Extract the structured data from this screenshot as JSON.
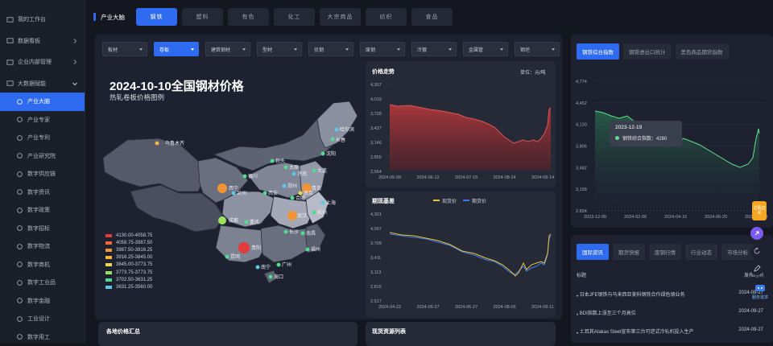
{
  "sidebar": {
    "items": [
      {
        "label": "我的工作台",
        "icon": "monitor-icon",
        "type": "top"
      },
      {
        "label": "数据看板",
        "icon": "dashboard-icon",
        "type": "top",
        "arrow": "right"
      },
      {
        "label": "企业内部管理",
        "icon": "building-icon",
        "type": "top",
        "arrow": "right"
      },
      {
        "label": "大数据赋能",
        "icon": "database-icon",
        "type": "top",
        "arrow": "down"
      },
      {
        "label": "产业大脑",
        "icon": "brain-icon",
        "type": "sub",
        "active": true
      },
      {
        "label": "产业专家",
        "icon": "expert-icon",
        "type": "sub"
      },
      {
        "label": "产业专利",
        "icon": "patent-icon",
        "type": "sub"
      },
      {
        "label": "产业研究院",
        "icon": "research-icon",
        "type": "sub"
      },
      {
        "label": "数字供应链",
        "icon": "supply-chain-icon",
        "type": "sub"
      },
      {
        "label": "数字资讯",
        "icon": "news-icon",
        "type": "sub"
      },
      {
        "label": "数字政策",
        "icon": "policy-icon",
        "type": "sub"
      },
      {
        "label": "数字招标",
        "icon": "bid-icon",
        "type": "sub"
      },
      {
        "label": "数字物流",
        "icon": "truck-icon",
        "type": "sub"
      },
      {
        "label": "数字商机",
        "icon": "opportunity-icon",
        "type": "sub"
      },
      {
        "label": "数字工业品",
        "icon": "product-icon",
        "type": "sub"
      },
      {
        "label": "数字金融",
        "icon": "finance-icon",
        "type": "sub"
      },
      {
        "label": "工业设计",
        "icon": "design-icon",
        "type": "sub"
      },
      {
        "label": "数字用工",
        "icon": "worker-icon",
        "type": "sub"
      }
    ]
  },
  "header": {
    "brand": "产业大脑",
    "tabs": [
      "钢铁",
      "塑料",
      "有色",
      "化工",
      "大宗商品",
      "纺织",
      "食品"
    ],
    "active_tab": 0
  },
  "filters": {
    "items": [
      "板材",
      "卷板",
      "建筑钢材",
      "型材",
      "优钢",
      "废钢",
      "冷镀",
      "金属管",
      "钢坯"
    ],
    "active": 1
  },
  "map": {
    "title": "2024-10-10全国钢材价格",
    "subtitle": "热轧卷板价格图例",
    "cities": [
      "乌鲁木齐",
      "哈尔滨",
      "长春",
      "沈阳",
      "包头",
      "大连",
      "银川",
      "太原",
      "济南",
      "西宁",
      "兰州",
      "郑州",
      "西安",
      "青岛",
      "合肥",
      "南京",
      "上海",
      "杭州",
      "武汉",
      "成都",
      "重庆",
      "长沙",
      "南昌",
      "福州",
      "贵阳",
      "昆明",
      "南宁",
      "广州",
      "海口"
    ],
    "legend": [
      {
        "label": "4130.00-4058.75",
        "color": "#e23b3b"
      },
      {
        "label": "4058.75-3987.50",
        "color": "#ef6a3a"
      },
      {
        "label": "3987.50-3916.25",
        "color": "#f09438"
      },
      {
        "label": "3916.25-3845.00",
        "color": "#f4b43f"
      },
      {
        "label": "3845.00-3773.75",
        "color": "#e8d84a"
      },
      {
        "label": "3773.75-3773.75",
        "color": "#9be35a"
      },
      {
        "label": "3702.50-3631.25",
        "color": "#55d98f"
      },
      {
        "label": "3631.25-3560.00",
        "color": "#5ec7e8"
      }
    ]
  },
  "price_trend": {
    "title": "价格走势",
    "unit": "单位：元/吨",
    "y_ticks": [
      "4,307",
      "4,019",
      "3,728",
      "3,437",
      "3,146",
      "2,855",
      "2,564"
    ],
    "x_ticks": [
      "2024-05-09",
      "2024-06-12",
      "2024-07-15",
      "2024-08-14",
      "2024-09-14"
    ]
  },
  "futures": {
    "title": "期现基差",
    "legend": [
      "现货价",
      "期货价"
    ],
    "y_ticks": [
      "4,301",
      "4,007",
      "3,709",
      "3,411",
      "3,113",
      "2,815",
      "2,517"
    ],
    "x_ticks": [
      "2024-04-22",
      "2024-05-27",
      "2024-06-27",
      "2024-08-06",
      "2024-09-11"
    ]
  },
  "bottom_left_title": "各地价格汇总",
  "bottom_mid_title": "现货资源列表",
  "index_panel": {
    "tabs": [
      "钢铁综合指数",
      "钢铁进出口统计",
      "黑色商品期货指数"
    ],
    "active": 0,
    "y_ticks": [
      "4,774",
      "4,452",
      "4,130",
      "3,806",
      "3,482",
      "3,158",
      "2,834"
    ],
    "x_ticks": [
      "2023-12-06",
      "2024-02-06",
      "2024-04-16",
      "2024-06-20",
      "2024-08-28"
    ],
    "tooltip_date": "2023-12-19",
    "tooltip_series": "钢铁综合指数：4280"
  },
  "news_panel": {
    "tabs": [
      "国际资讯",
      "期货快报",
      "废钢行情",
      "行业动态",
      "市场分析"
    ],
    "active": 0,
    "col_title": "标题",
    "col_date": "发布时间",
    "rows": [
      {
        "title": "日本JFE钢铁与马来西亚美科钢铁合作绿色钢业务",
        "date": "2024-09-27"
      },
      {
        "title": "BDI指数上涨至三个月高位",
        "date": "2024-09-27"
      },
      {
        "title": "土耳其Atakas Steel宣布第三台可逆式冷轧机投入生产",
        "date": "2024-09-27"
      }
    ]
  },
  "floating": {
    "top_label": "边看边买",
    "bottom_label": "服务需求"
  },
  "colors": {
    "accent": "#2f6bf0",
    "background": "#14171f",
    "panel": "#1e2230"
  }
}
